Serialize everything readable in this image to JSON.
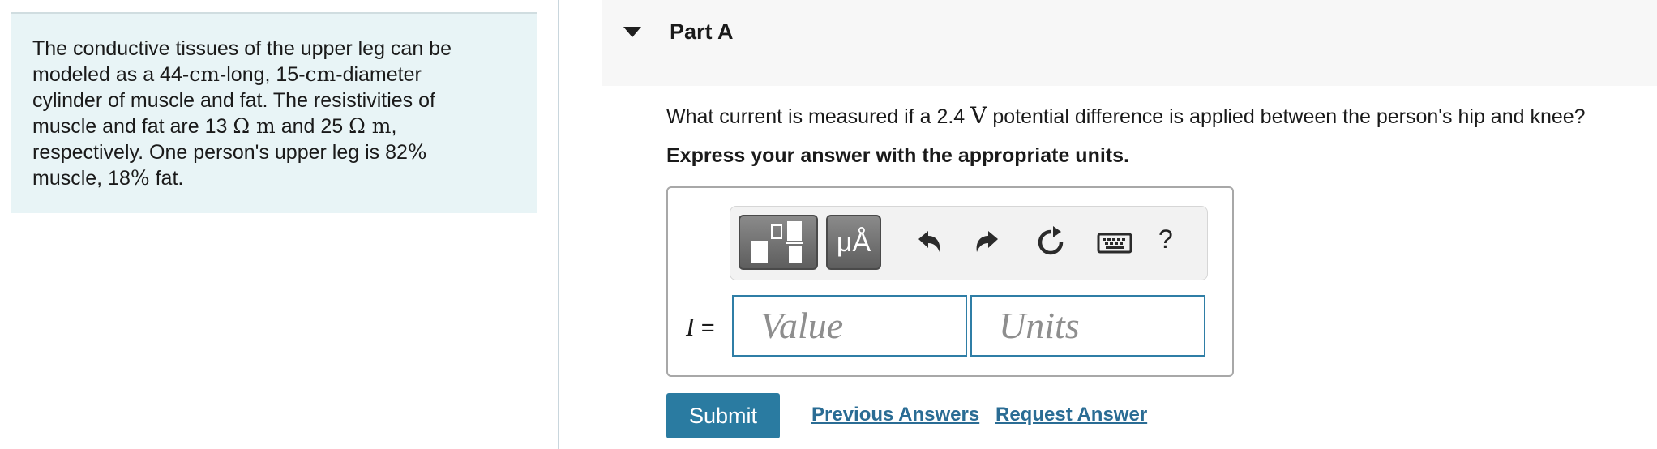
{
  "problem": {
    "lines": [
      "The conductive tissues of the upper leg can be",
      "modeled as a 44-",
      "cm",
      "-long, 15-",
      "cm",
      "-diameter",
      "cylinder of muscle and fat. The resistivities of",
      "muscle and fat are 13 ",
      "Ω m",
      " and 25 ",
      "Ω m",
      ",",
      "respectively. One person's upper leg is 82",
      "%",
      "muscle, 18",
      "%",
      " fat."
    ]
  },
  "part": {
    "title": "Part A",
    "expanded": true
  },
  "question": {
    "pre": "What current is measured if a 2.4 ",
    "unit": "V",
    "post": " potential difference is applied between the person's hip and knee?"
  },
  "instruction": "Express your answer with the appropriate units.",
  "toolbar": {
    "templates_icon": "templates-icon",
    "units_label": "μÅ",
    "undo_icon": "undo-icon",
    "redo_icon": "redo-icon",
    "reset_icon": "reset-icon",
    "keyboard_icon": "keyboard-icon",
    "help_label": "?"
  },
  "answer": {
    "variable": "I",
    "equals": " =",
    "value_placeholder": "Value",
    "units_placeholder": "Units"
  },
  "actions": {
    "submit_label": "Submit",
    "previous_answers_label": "Previous Answers",
    "request_answer_label": "Request Answer"
  },
  "colors": {
    "panel_bg": "#e8f4f6",
    "accent": "#2a7ba1",
    "link": "#2a6c94",
    "input_border": "#2f7ea6"
  }
}
